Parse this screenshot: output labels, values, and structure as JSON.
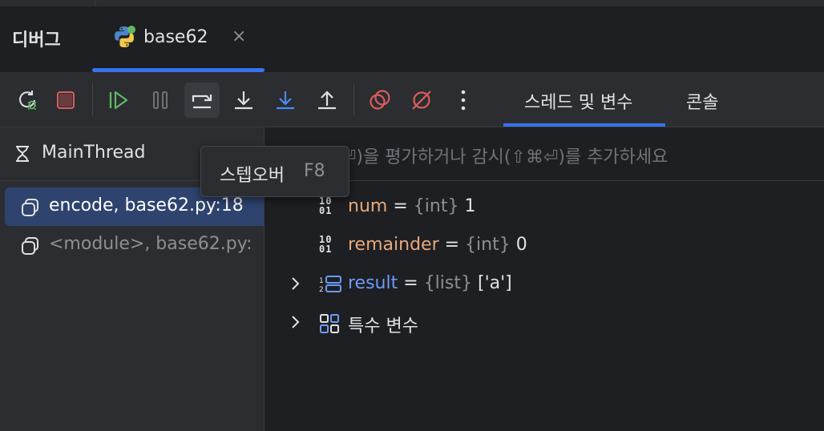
{
  "header": {
    "debug_title": "디버그",
    "tab": {
      "label": "base62",
      "close": "×"
    }
  },
  "toolbar": {
    "buttons": [
      {
        "name": "rerun-debug",
        "icon": "rerun-bug-icon"
      },
      {
        "name": "stop",
        "icon": "stop-icon"
      },
      {
        "name": "resume",
        "icon": "resume-icon"
      },
      {
        "name": "pause",
        "icon": "pause-icon"
      },
      {
        "name": "step-over",
        "icon": "step-over-icon"
      },
      {
        "name": "step-into",
        "icon": "step-into-icon"
      },
      {
        "name": "step-into-my-code",
        "icon": "step-into-my-code-icon"
      },
      {
        "name": "step-out",
        "icon": "step-out-icon"
      },
      {
        "name": "view-breakpoints",
        "icon": "breakpoints-icon"
      },
      {
        "name": "mute-breakpoints",
        "icon": "mute-breakpoints-icon"
      },
      {
        "name": "more",
        "icon": "more-vertical-icon"
      }
    ],
    "tabs": [
      {
        "label": "스레드 및 변수",
        "active": true
      },
      {
        "label": "콘솔",
        "active": false
      }
    ]
  },
  "threads": {
    "current": "MainThread",
    "frames": [
      {
        "label": "encode, base62.py:18",
        "selected": true
      },
      {
        "label": "<module>, base62.py:",
        "selected": false
      }
    ]
  },
  "evaluate": {
    "placeholder": "⏎)을  평가하거나  감시(⇧⌘⏎)를  추가하세요"
  },
  "variables": [
    {
      "name": "num",
      "eq": "=",
      "type": "{int}",
      "value": "1",
      "expandable": false,
      "icon": "binary-icon"
    },
    {
      "name": "remainder",
      "eq": "=",
      "type": "{int}",
      "value": "0",
      "expandable": false,
      "icon": "binary-icon"
    },
    {
      "name": "result",
      "eq": "=",
      "type": "{list}",
      "value": "['a']",
      "expandable": true,
      "icon": "list-icon"
    },
    {
      "name": "특수 변수",
      "eq": "",
      "type": "",
      "value": "",
      "expandable": true,
      "icon": "special-vars-icon"
    }
  ],
  "tooltip": {
    "label": "스텝오버",
    "shortcut": "F8"
  },
  "colors": {
    "accent": "#3574f0",
    "selection": "#2e436e",
    "var_name": "#e8a97b",
    "list_name": "#6b9bfa",
    "stop_red": "#db5c5c",
    "resume_green": "#5fb865"
  }
}
